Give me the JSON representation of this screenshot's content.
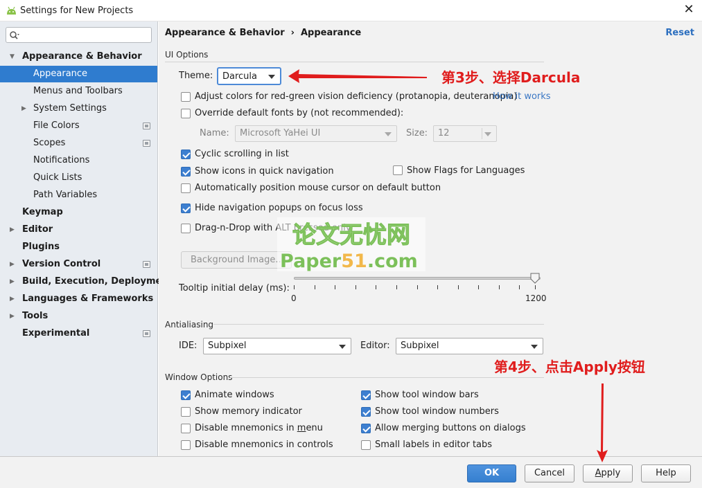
{
  "window": {
    "title": "Settings for New Projects",
    "close_symbol": "✕"
  },
  "search": {
    "placeholder": "",
    "icon": "search-icon"
  },
  "sidebar": {
    "items": [
      {
        "label": "Appearance & Behavior",
        "bold": true,
        "expanded": true
      },
      {
        "label": "Appearance",
        "selected": true
      },
      {
        "label": "Menus and Toolbars"
      },
      {
        "label": "System Settings",
        "collapsed": true
      },
      {
        "label": "File Colors",
        "project_icon": true
      },
      {
        "label": "Scopes",
        "project_icon": true
      },
      {
        "label": "Notifications"
      },
      {
        "label": "Quick Lists"
      },
      {
        "label": "Path Variables"
      },
      {
        "label": "Keymap",
        "bold": true
      },
      {
        "label": "Editor",
        "bold": true,
        "collapsed": true
      },
      {
        "label": "Plugins",
        "bold": true
      },
      {
        "label": "Version Control",
        "bold": true,
        "collapsed": true,
        "project_icon": true
      },
      {
        "label": "Build, Execution, Deployment",
        "bold": true,
        "collapsed": true
      },
      {
        "label": "Languages & Frameworks",
        "bold": true,
        "collapsed": true
      },
      {
        "label": "Tools",
        "bold": true,
        "collapsed": true
      },
      {
        "label": "Experimental",
        "bold": true,
        "project_icon": true
      }
    ]
  },
  "header": {
    "breadcrumb_parent": "Appearance & Behavior",
    "breadcrumb_sep": "›",
    "breadcrumb_current": "Appearance",
    "reset": "Reset"
  },
  "ui_options": {
    "group_label": "UI Options",
    "theme_label": "Theme:",
    "theme_value": "Darcula",
    "adjust_colors": {
      "label": "Adjust colors for red-green vision deficiency (protanopia, deuteranopia)",
      "checked": false
    },
    "how_it_works": "How it works",
    "override_fonts": {
      "label": "Override default fonts by (not recommended):",
      "checked": false
    },
    "name_label": "Name:",
    "name_value": "Microsoft YaHei UI",
    "size_label": "Size:",
    "size_value": "12",
    "cyclic_scrolling": {
      "label": "Cyclic scrolling in list",
      "checked": true
    },
    "show_icons": {
      "label": "Show icons in quick navigation",
      "checked": true
    },
    "show_flags": {
      "label": "Show Flags for Languages",
      "checked": false
    },
    "auto_position": {
      "label": "Automatically position mouse cursor on default button",
      "checked": false
    },
    "hide_nav_popups": {
      "label": "Hide navigation popups on focus loss",
      "checked": true
    },
    "drag_n_drop": {
      "label": "Drag-n-Drop with ALT pressed only",
      "checked": false
    },
    "background_image": "Background Image...",
    "tooltip_label": "Tooltip initial delay (ms):",
    "tooltip_min": "0",
    "tooltip_max": "1200",
    "tooltip_value": 1200
  },
  "antialiasing": {
    "group_label": "Antialiasing",
    "ide_label": "IDE:",
    "ide_value": "Subpixel",
    "editor_label": "Editor:",
    "editor_value": "Subpixel"
  },
  "window_options": {
    "group_label": "Window Options",
    "animate_windows": {
      "label": "Animate windows",
      "checked": true
    },
    "show_memory": {
      "label": "Show memory indicator",
      "checked": false
    },
    "disable_mnemonics_menu": {
      "label_pre": "Disable mnemonics in ",
      "label_u": "m",
      "label_post": "enu",
      "checked": false
    },
    "disable_mnemonics_controls": {
      "label": "Disable mnemonics in controls",
      "checked": false
    },
    "show_tool_bars": {
      "label": "Show tool window bars",
      "checked": true
    },
    "show_tool_numbers": {
      "label": "Show tool window numbers",
      "checked": true
    },
    "allow_merging": {
      "label": "Allow merging buttons on dialogs",
      "checked": true
    },
    "small_labels": {
      "label": "Small labels in editor tabs",
      "checked": false
    }
  },
  "footer": {
    "ok": "OK",
    "cancel": "Cancel",
    "apply_u": "A",
    "apply_rest": "pply",
    "help": "Help"
  },
  "annotations": {
    "step3": "第3步、选择Darcula",
    "step4": "第4步、点击Apply按钮",
    "color": "#e01d1d"
  },
  "watermark": {
    "line1": "论文无忧网",
    "line2_a": "Paper",
    "line2_b": "51",
    "line2_c": ".com"
  }
}
